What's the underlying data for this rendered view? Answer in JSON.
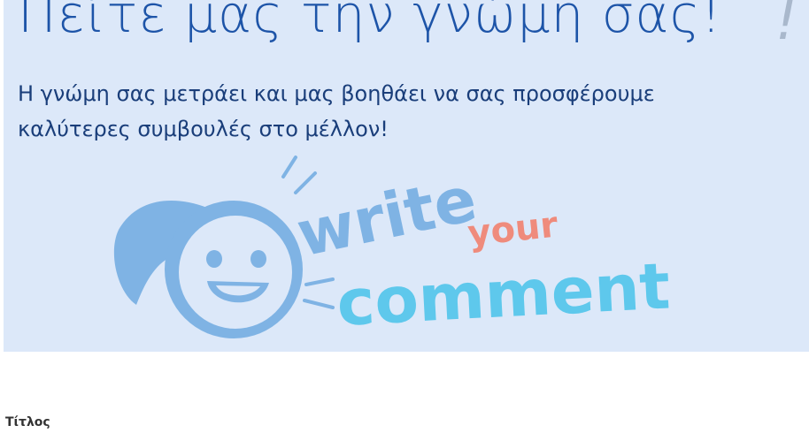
{
  "banner": {
    "headline": "Πείτε μας την γνώμη σας!",
    "exclamation_mark": "!",
    "subtext": "Η γνώμη σας μετράει και μας βοηθάει να σας προσφέρουμε καλύτερες συμβουλές στο μέλλον!",
    "illustration": {
      "word_write": "write",
      "word_your": "your",
      "word_comment": "comment"
    }
  },
  "form": {
    "title_label": "Τίτλος"
  },
  "colors": {
    "banner_bg": "#dce8f9",
    "headline": "#1d54a8",
    "illustration_blue": "#7fb3e4",
    "illustration_cyan": "#5ec8ec",
    "illustration_coral": "#ef8b7c"
  }
}
